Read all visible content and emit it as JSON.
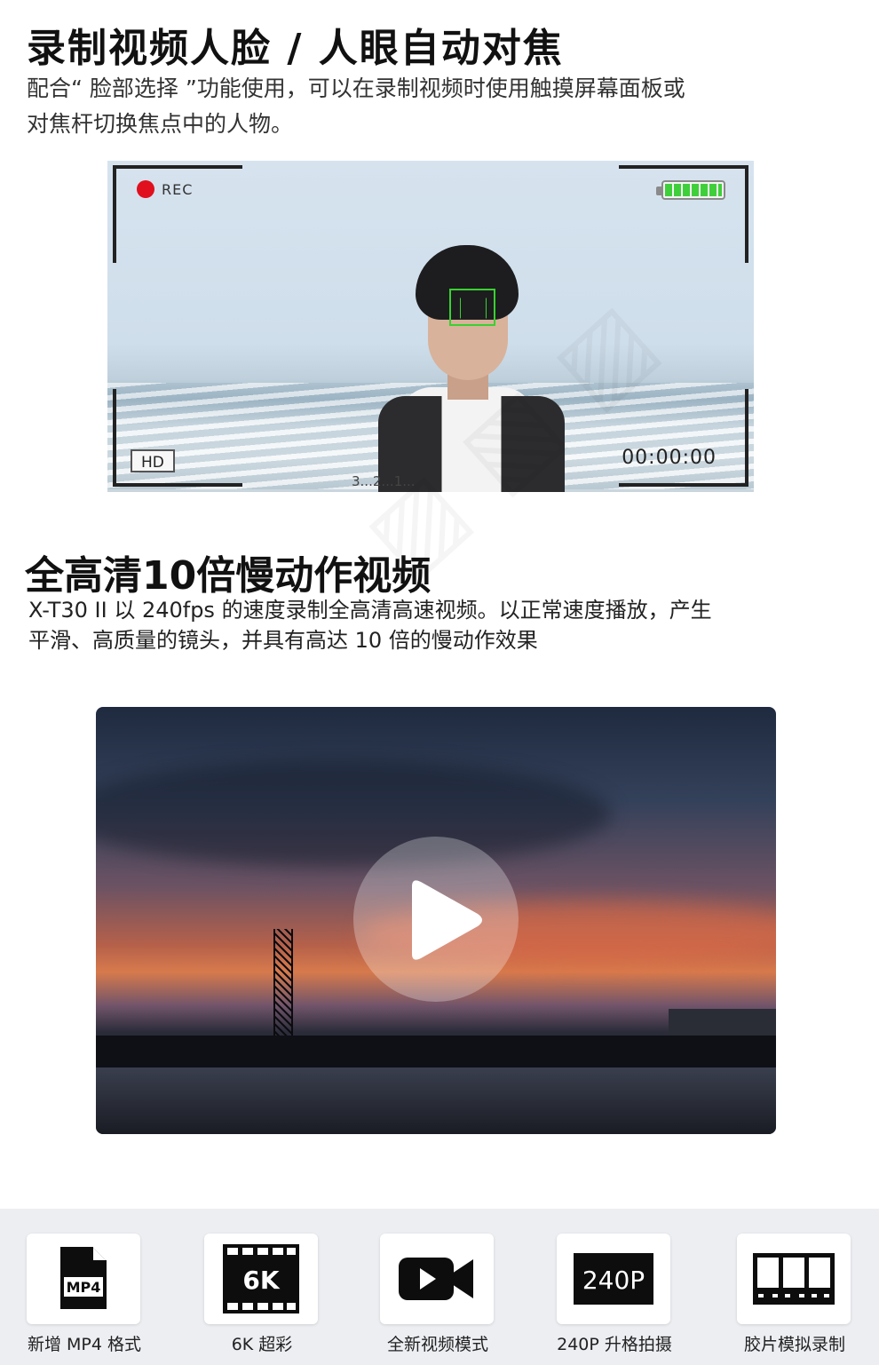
{
  "section1": {
    "title": "录制视频人脸 / 人眼自动对焦",
    "desc": "配合“ 脸部选择 ”功能使用，可以在录制视频时使用触摸屏幕面板或对焦杆切换焦点中的人物。"
  },
  "viewfinder": {
    "rec_label": "REC",
    "quality_badge": "HD",
    "timecode": "00:00:00",
    "countdown": "3...2...1...",
    "battery_level": 1.0,
    "colors": {
      "rec": "#e0101e",
      "focus_box": "#39d131",
      "battery": "#3fcf3b"
    }
  },
  "section2": {
    "title": "全高清10倍慢动作视频",
    "desc": "X-T30 II 以 240fps 的速度录制全高清高速视频。以正常速度播放，产生平滑、高质量的镜头，并具有高达 10 倍的慢动作效果"
  },
  "video": {
    "play_icon": "play-icon"
  },
  "features": [
    {
      "label": "新增 MP4 格式",
      "icon": "mp4-file-icon",
      "glyph": "MP4"
    },
    {
      "label": "6K 超彩",
      "icon": "film-6k-icon",
      "glyph": "6K"
    },
    {
      "label": "全新视频模式",
      "icon": "video-camera-icon",
      "glyph": ""
    },
    {
      "label": "240P 升格拍摄",
      "icon": "240p-icon",
      "glyph": "240P"
    },
    {
      "label": "胶片模拟录制",
      "icon": "film-strip-icon",
      "glyph": ""
    }
  ]
}
